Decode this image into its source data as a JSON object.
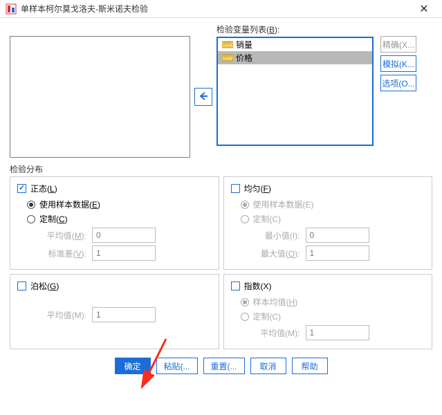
{
  "window": {
    "title": "单样本柯尔莫戈洛夫-斯米诺夫检验"
  },
  "lists": {
    "target_label_pre": "检验变量列表(",
    "target_label_u": "B",
    "target_label_post": "):",
    "target_items": [
      {
        "label": "销量",
        "selected": false
      },
      {
        "label": "价格",
        "selected": true
      }
    ]
  },
  "side": {
    "exact": "精确(X...",
    "simulate": "模拟(K...",
    "options": "选项(O..."
  },
  "distribution": {
    "heading": "检验分布",
    "normal": {
      "label_pre": "正态(",
      "label_u": "L",
      "label_post": ")",
      "checked": true,
      "use_sample_pre": "使用样本数据(",
      "use_sample_u": "E",
      "use_sample_post": ")",
      "custom_pre": "定制(",
      "custom_u": "C",
      "custom_post": ")",
      "mean_pre": "平均值(",
      "mean_u": "M",
      "mean_post": "):",
      "mean_value": "0",
      "sd_pre": "标准差(",
      "sd_u": "V",
      "sd_post": "):",
      "sd_value": "1"
    },
    "uniform": {
      "label_pre": "均匀(",
      "label_u": "F",
      "label_post": ")",
      "checked": false,
      "use_sample": "使用样本数据(E)",
      "custom": "定制(C)",
      "min_label": "最小值(I):",
      "min_value": "0",
      "max_pre": "最大值(",
      "max_u": "Q",
      "max_post": "):",
      "max_value": "1"
    },
    "poisson": {
      "label_pre": "泊松(",
      "label_u": "G",
      "label_post": ")",
      "checked": false,
      "mean_label": "平均值(M):",
      "mean_value": "1"
    },
    "exponential": {
      "label": "指数(X)",
      "checked": false,
      "sample_mean_pre": "样本均值(",
      "sample_mean_u": "H",
      "sample_mean_post": ")",
      "custom": "定制(C)",
      "mean_label": "平均值(M):",
      "mean_value": "1"
    }
  },
  "buttons": {
    "ok": "确定",
    "paste": "粘贴(...",
    "reset": "重置(...",
    "cancel": "取消",
    "help": "帮助"
  }
}
